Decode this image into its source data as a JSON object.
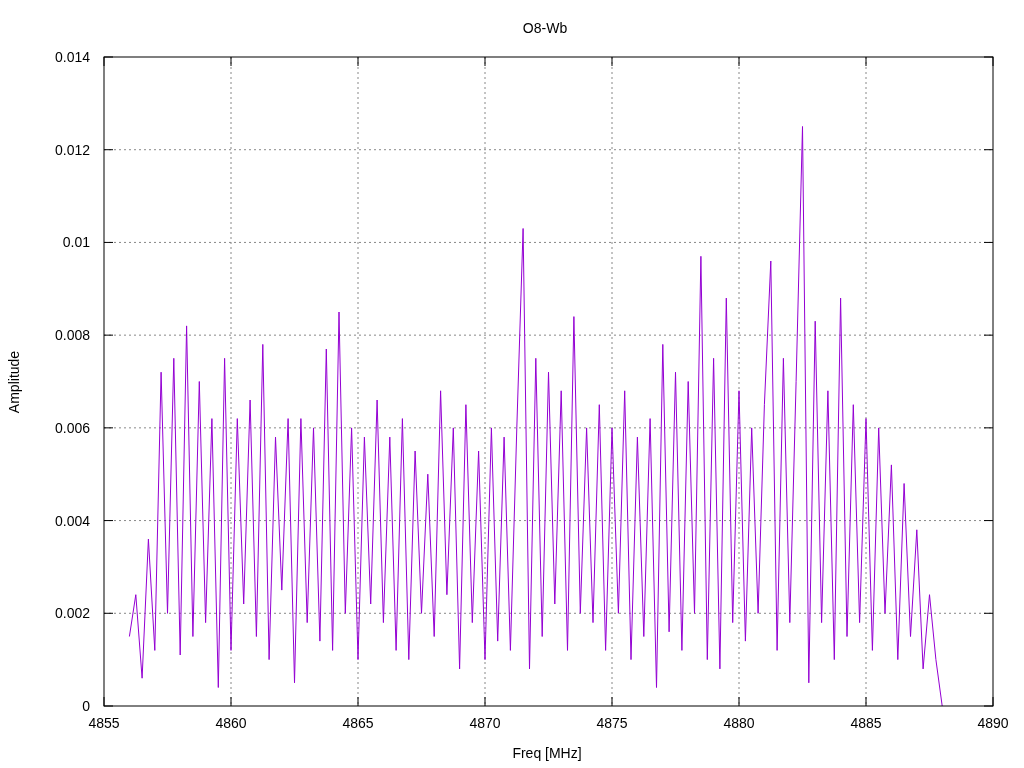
{
  "plot": {
    "chart_data": {
      "type": "line",
      "title": "O8-Wb",
      "xlabel": "Freq [MHz]",
      "ylabel": "Amplitude",
      "grid": true,
      "xlim": [
        4855,
        4890
      ],
      "ylim": [
        0,
        0.014
      ],
      "xticks": [
        4855,
        4860,
        4865,
        4870,
        4875,
        4880,
        4885,
        4890
      ],
      "yticks": [
        0,
        0.002,
        0.004,
        0.006,
        0.008,
        0.01,
        0.012,
        0.014
      ],
      "x": [
        4856,
        4856.25,
        4856.5,
        4856.75,
        4857,
        4857.25,
        4857.5,
        4857.75,
        4858,
        4858.25,
        4858.5,
        4858.75,
        4859,
        4859.25,
        4859.5,
        4859.75,
        4860,
        4860.25,
        4860.5,
        4860.75,
        4861,
        4861.25,
        4861.5,
        4861.75,
        4862,
        4862.25,
        4862.5,
        4862.75,
        4863,
        4863.25,
        4863.5,
        4863.75,
        4864,
        4864.25,
        4864.5,
        4864.75,
        4865,
        4865.25,
        4865.5,
        4865.75,
        4866,
        4866.25,
        4866.5,
        4866.75,
        4867,
        4867.25,
        4867.5,
        4867.75,
        4868,
        4868.25,
        4868.5,
        4868.75,
        4869,
        4869.25,
        4869.5,
        4869.75,
        4870,
        4870.25,
        4870.5,
        4870.75,
        4871,
        4871.25,
        4871.5,
        4871.75,
        4872,
        4872.25,
        4872.5,
        4872.75,
        4873,
        4873.25,
        4873.5,
        4873.75,
        4874,
        4874.25,
        4874.5,
        4874.75,
        4875,
        4875.25,
        4875.5,
        4875.75,
        4876,
        4876.25,
        4876.5,
        4876.75,
        4877,
        4877.25,
        4877.5,
        4877.75,
        4878,
        4878.25,
        4878.5,
        4878.75,
        4879,
        4879.25,
        4879.5,
        4879.75,
        4880,
        4880.25,
        4880.5,
        4880.75,
        4881,
        4881.25,
        4881.5,
        4881.75,
        4882,
        4882.25,
        4882.5,
        4882.75,
        4883,
        4883.25,
        4883.5,
        4883.75,
        4884,
        4884.25,
        4884.5,
        4884.75,
        4885,
        4885.25,
        4885.5,
        4885.75,
        4886,
        4886.25,
        4886.5,
        4886.75,
        4887,
        4887.25,
        4887.5,
        4887.75,
        4888
      ],
      "series": [
        {
          "color": "#9400d3",
          "values": [
            0.0015,
            0.0024,
            0.0006,
            0.0036,
            0.0012,
            0.0072,
            0.002,
            0.0075,
            0.0011,
            0.0082,
            0.0015,
            0.007,
            0.0018,
            0.0062,
            0.0004,
            0.0075,
            0.0012,
            0.0062,
            0.0022,
            0.0066,
            0.0015,
            0.0078,
            0.001,
            0.0058,
            0.0025,
            0.0062,
            0.0005,
            0.0062,
            0.0018,
            0.006,
            0.0014,
            0.0077,
            0.0012,
            0.0085,
            0.002,
            0.006,
            0.001,
            0.0058,
            0.0022,
            0.0066,
            0.0018,
            0.0058,
            0.0012,
            0.0062,
            0.001,
            0.0055,
            0.002,
            0.005,
            0.0015,
            0.0068,
            0.0024,
            0.006,
            0.0008,
            0.0065,
            0.0018,
            0.0055,
            0.001,
            0.006,
            0.0014,
            0.0058,
            0.0012,
            0.006,
            0.0103,
            0.0008,
            0.0075,
            0.0015,
            0.0072,
            0.0022,
            0.0068,
            0.0012,
            0.0084,
            0.002,
            0.006,
            0.0018,
            0.0065,
            0.0012,
            0.006,
            0.002,
            0.0068,
            0.001,
            0.0058,
            0.0015,
            0.0062,
            0.0004,
            0.0078,
            0.0016,
            0.0072,
            0.0012,
            0.007,
            0.002,
            0.0097,
            0.001,
            0.0075,
            0.0008,
            0.0088,
            0.0018,
            0.0068,
            0.0014,
            0.006,
            0.002,
            0.0065,
            0.0096,
            0.0012,
            0.0075,
            0.0018,
            0.007,
            0.0125,
            0.0005,
            0.0083,
            0.0018,
            0.0068,
            0.001,
            0.0088,
            0.0015,
            0.0065,
            0.0018,
            0.0062,
            0.0012,
            0.006,
            0.002,
            0.0052,
            0.001,
            0.0048,
            0.0015,
            0.0038,
            0.0008,
            0.0024,
            0.001,
            0
          ]
        }
      ]
    }
  }
}
